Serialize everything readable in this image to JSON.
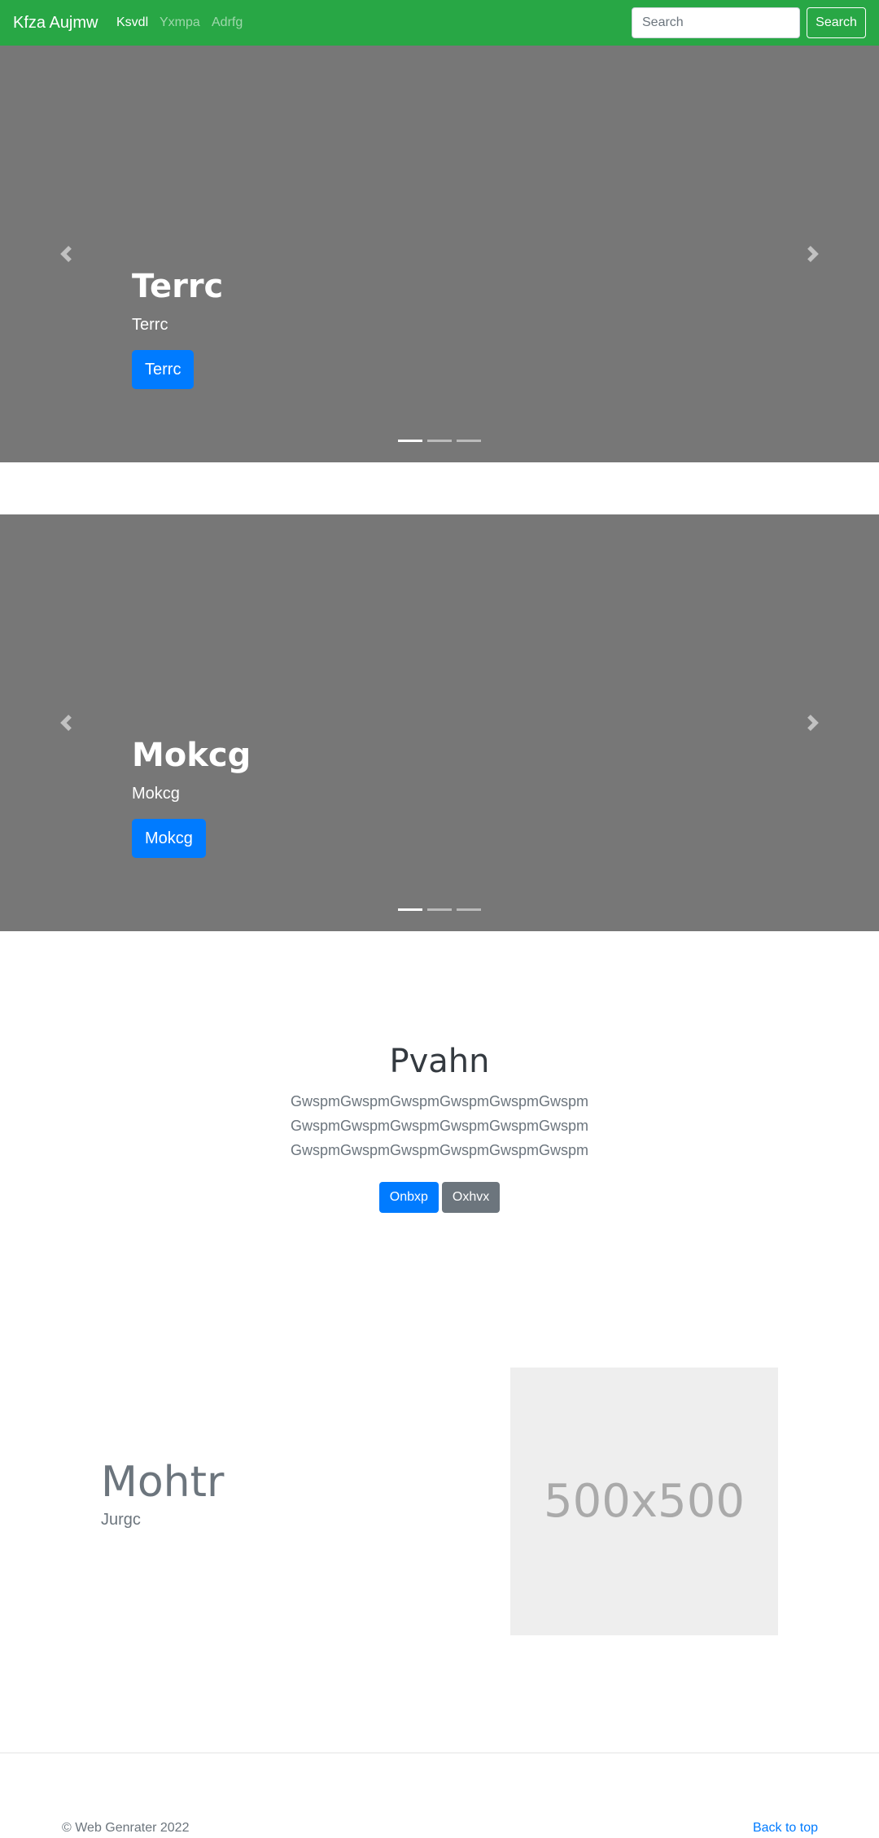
{
  "navbar": {
    "brand": "Kfza Aujmw",
    "links": [
      {
        "label": "Ksvdl",
        "active": true
      },
      {
        "label": "Yxmpa",
        "active": false
      },
      {
        "label": "Adrfg",
        "active": false
      }
    ],
    "search_placeholder": "Search",
    "search_button": "Search"
  },
  "carousels": [
    {
      "title": "Terrc",
      "text": "Terrc",
      "button": "Terrc",
      "slide_count": 3,
      "active_slide": 1
    },
    {
      "title": "Mokcg",
      "text": "Mokcg",
      "button": "Mokcg",
      "slide_count": 3,
      "active_slide": 1
    }
  ],
  "jumbotron": {
    "heading": "Pvahn",
    "text": "GwspmGwspmGwspmGwspmGwspmGwspmGwspmGwspmGwspmGwspmGwspmGwspmGwspmGwspmGwspmGwspmGwspmGwspm",
    "primary_button": "Onbxp",
    "secondary_button": "Oxhvx"
  },
  "featurette": {
    "heading": "Mohtr",
    "subheading": "Jurgc",
    "image_text": "500x500"
  },
  "footer": {
    "copyright": "© Web Genrater 2022",
    "back_to_top": "Back to top"
  },
  "colors": {
    "navbar_bg": "#28a745",
    "carousel_bg": "#777777",
    "primary": "#007bff",
    "secondary": "#6c757d"
  },
  "icons": {
    "prev": "chevron-left-icon",
    "next": "chevron-right-icon"
  }
}
